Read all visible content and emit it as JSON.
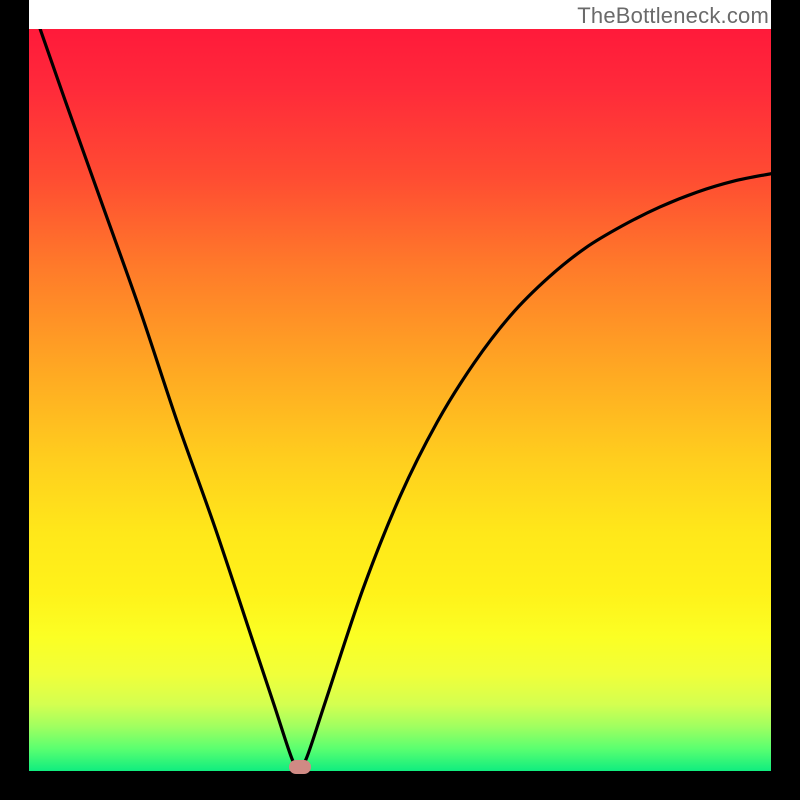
{
  "watermark": "TheBottleneck.com",
  "colors": {
    "frame": "#000000",
    "watermark_text": "#6a6a6a",
    "curve": "#000000",
    "marker": "#d08a84",
    "gradient_top": "#ff1a3a",
    "gradient_bottom": "#10ed7f"
  },
  "chart_data": {
    "type": "line",
    "title": "",
    "xlabel": "",
    "ylabel": "",
    "xlim": [
      0,
      1
    ],
    "ylim": [
      0,
      1
    ],
    "grid": false,
    "legend": false,
    "annotations": [
      "TheBottleneck.com"
    ],
    "series": [
      {
        "name": "bottleneck-curve",
        "x": [
          0.015,
          0.05,
          0.1,
          0.15,
          0.2,
          0.25,
          0.3,
          0.33,
          0.355,
          0.365,
          0.375,
          0.4,
          0.45,
          0.5,
          0.55,
          0.6,
          0.65,
          0.7,
          0.75,
          0.8,
          0.85,
          0.9,
          0.95,
          1.0
        ],
        "y": [
          1.0,
          0.9,
          0.76,
          0.62,
          0.47,
          0.33,
          0.18,
          0.09,
          0.015,
          0.005,
          0.02,
          0.095,
          0.245,
          0.37,
          0.47,
          0.55,
          0.615,
          0.665,
          0.705,
          0.735,
          0.76,
          0.78,
          0.795,
          0.805
        ]
      }
    ],
    "marker": {
      "x": 0.365,
      "y": 0.006
    },
    "notes": "V-shaped bottleneck curve on vertical rainbow gradient; minimum near x≈0.365. y=0 is bottom (green), y=1 is top (red). Values estimated from pixels; no axes/ticks visible."
  }
}
